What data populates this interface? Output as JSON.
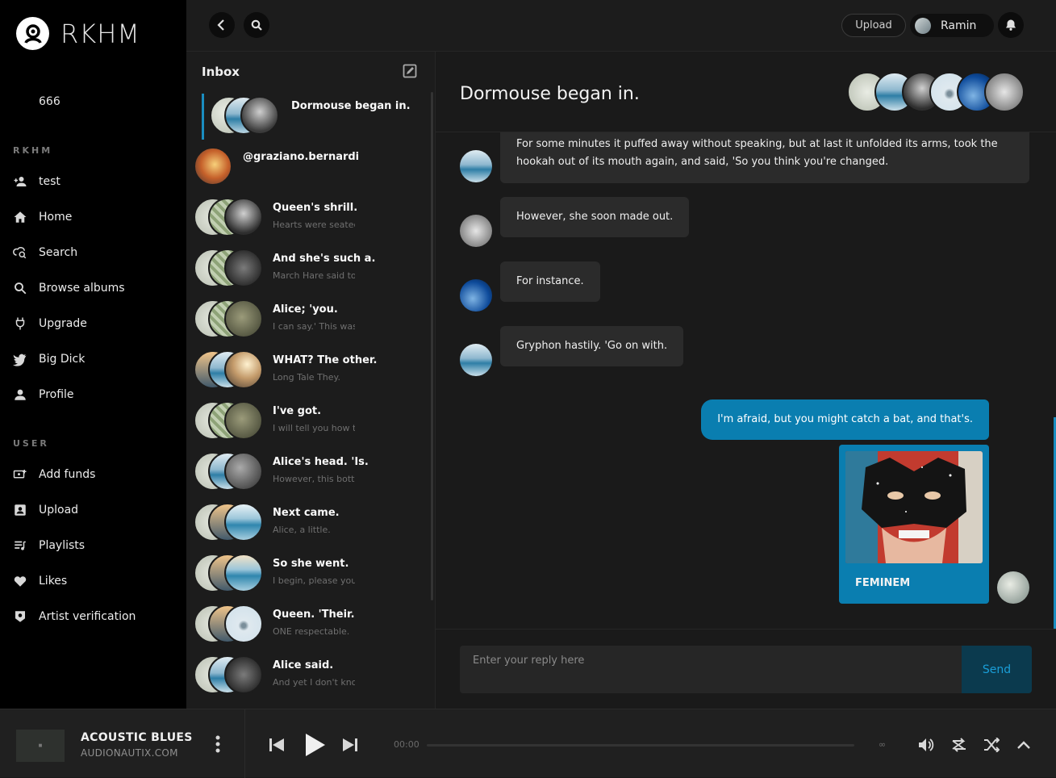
{
  "app": {
    "name": "RKHM",
    "balance": "666"
  },
  "sidebar": {
    "section_rkhm": "RKHM",
    "section_user": "USER",
    "rkhm_items": [
      {
        "label": "test",
        "icon": "add-user-icon"
      },
      {
        "label": "Home",
        "icon": "home-icon"
      },
      {
        "label": "Search",
        "icon": "search-cloud-icon"
      },
      {
        "label": "Browse albums",
        "icon": "search-icon"
      },
      {
        "label": "Upgrade",
        "icon": "plug-icon"
      },
      {
        "label": "Big Dick",
        "icon": "bird-icon"
      },
      {
        "label": "Profile",
        "icon": "person-icon"
      }
    ],
    "user_items": [
      {
        "label": "Add funds",
        "icon": "add-funds-icon"
      },
      {
        "label": "Upload",
        "icon": "upload-icon"
      },
      {
        "label": "Playlists",
        "icon": "playlist-icon"
      },
      {
        "label": "Likes",
        "icon": "heart-icon"
      },
      {
        "label": "Artist verification",
        "icon": "badge-icon"
      }
    ]
  },
  "topbar": {
    "upload_label": "Upload",
    "user_name": "Ramin"
  },
  "inbox": {
    "title": "Inbox",
    "threads": [
      {
        "title": "Dormouse began in.",
        "preview": ""
      },
      {
        "title": "@graziano.bernardi",
        "preview": ""
      },
      {
        "title": "Queen's shrill.",
        "preview": "Hearts were seated"
      },
      {
        "title": "And she's such a.",
        "preview": "March Hare said to."
      },
      {
        "title": "Alice; 'you.",
        "preview": "I can say.' This was s"
      },
      {
        "title": "WHAT? The other.",
        "preview": "Long Tale They."
      },
      {
        "title": "I've got.",
        "preview": "I will tell you how th"
      },
      {
        "title": "Alice's head. 'Is.",
        "preview": "However, this bottle"
      },
      {
        "title": "Next came.",
        "preview": "Alice, a little."
      },
      {
        "title": "So she went.",
        "preview": "I begin, please your"
      },
      {
        "title": "Queen. 'Their.",
        "preview": "ONE respectable."
      },
      {
        "title": "Alice said.",
        "preview": "And yet I don't know"
      }
    ]
  },
  "conversation": {
    "title": "Dormouse began in.",
    "messages": [
      {
        "text": "For some minutes it puffed away without speaking, but at last it unfolded its arms, took the hookah out of its mouth again, and said, 'So you think you're changed."
      },
      {
        "text": "However, she soon made out."
      },
      {
        "text": "For instance."
      },
      {
        "text": "Gryphon hastily. 'Go on with."
      }
    ],
    "my_message": "I'm afraid, but you might catch a bat, and that's.",
    "shared_track": "FEMINEM",
    "reply_placeholder": "Enter your reply here",
    "send_label": "Send"
  },
  "player": {
    "track_title": "ACOUSTIC BLUES",
    "track_artist": "AUDIONAUTIX.COM",
    "current_time": "00:00",
    "duration": "∞",
    "progress": 0
  },
  "colors": {
    "accent": "#0a7eb0",
    "sidebar_bg": "#000000",
    "panel_bg": "#1c1c1c"
  }
}
